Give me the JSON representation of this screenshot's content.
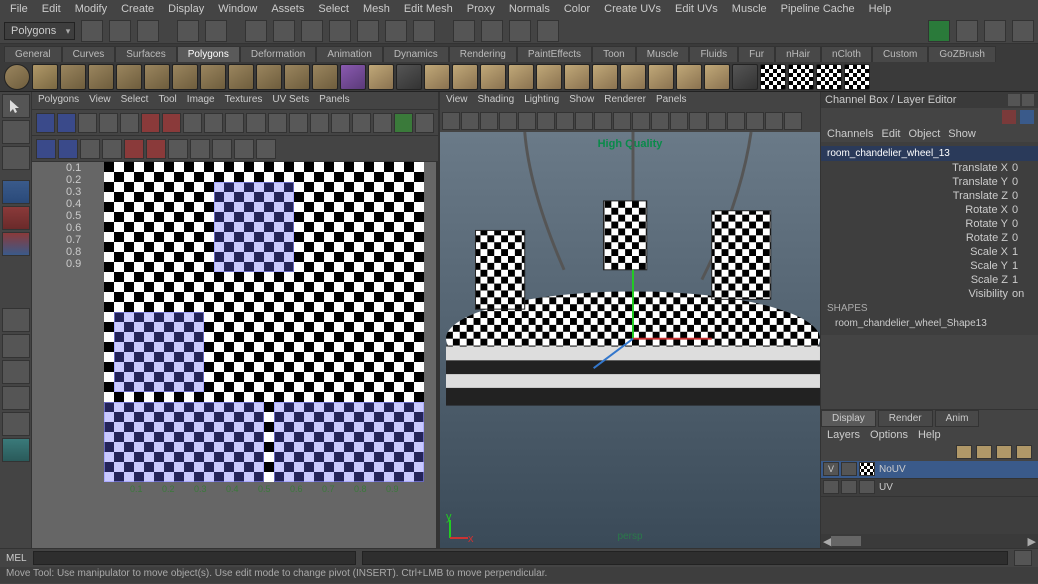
{
  "menu": [
    "File",
    "Edit",
    "Modify",
    "Create",
    "Display",
    "Window",
    "Assets",
    "Select",
    "Mesh",
    "Edit Mesh",
    "Proxy",
    "Normals",
    "Color",
    "Create UVs",
    "Edit UVs",
    "Muscle",
    "Pipeline Cache",
    "Help"
  ],
  "module_combo": "Polygons",
  "shelf_tabs": [
    "General",
    "Curves",
    "Surfaces",
    "Polygons",
    "Deformation",
    "Animation",
    "Dynamics",
    "Rendering",
    "PaintEffects",
    "Toon",
    "Muscle",
    "Fluids",
    "Fur",
    "nHair",
    "nCloth",
    "Custom",
    "GoZBrush"
  ],
  "shelf_active": 3,
  "uv_panel_menu": [
    "Polygons",
    "View",
    "Select",
    "Tool",
    "Image",
    "Textures",
    "UV Sets",
    "Panels"
  ],
  "uv_grid_labels": [
    "0.1",
    "0.2",
    "0.3",
    "0.4",
    "0.5",
    "0.6",
    "0.7",
    "0.8",
    "0.9"
  ],
  "persp_panel_menu": [
    "View",
    "Shading",
    "Lighting",
    "Show",
    "Renderer",
    "Panels"
  ],
  "persp_quality": "High Quality",
  "persp_label": "persp",
  "channel_box_title": "Channel Box / Layer Editor",
  "channel_menu": [
    "Channels",
    "Edit",
    "Object",
    "Show"
  ],
  "object_name": "room_chandelier_wheel_13",
  "attrs": [
    {
      "lbl": "Translate X",
      "val": "0"
    },
    {
      "lbl": "Translate Y",
      "val": "0"
    },
    {
      "lbl": "Translate Z",
      "val": "0"
    },
    {
      "lbl": "Rotate X",
      "val": "0"
    },
    {
      "lbl": "Rotate Y",
      "val": "0"
    },
    {
      "lbl": "Rotate Z",
      "val": "0"
    },
    {
      "lbl": "Scale X",
      "val": "1"
    },
    {
      "lbl": "Scale Y",
      "val": "1"
    },
    {
      "lbl": "Scale Z",
      "val": "1"
    },
    {
      "lbl": "Visibility",
      "val": "on"
    }
  ],
  "shapes_label": "SHAPES",
  "shape_name": "room_chandelier_wheel_Shape13",
  "layer_tabs": [
    "Display",
    "Render",
    "Anim"
  ],
  "layer_tab_active": 0,
  "layer_menu": [
    "Layers",
    "Options",
    "Help"
  ],
  "layers": [
    {
      "v": "V",
      "name": "NoUV",
      "sel": true,
      "chk": true
    },
    {
      "v": "",
      "name": "UV",
      "sel": false,
      "chk": false
    }
  ],
  "mel_label": "MEL",
  "status_text": "Move Tool: Use manipulator to move object(s). Use edit mode to change pivot (INSERT). Ctrl+LMB to move perpendicular."
}
